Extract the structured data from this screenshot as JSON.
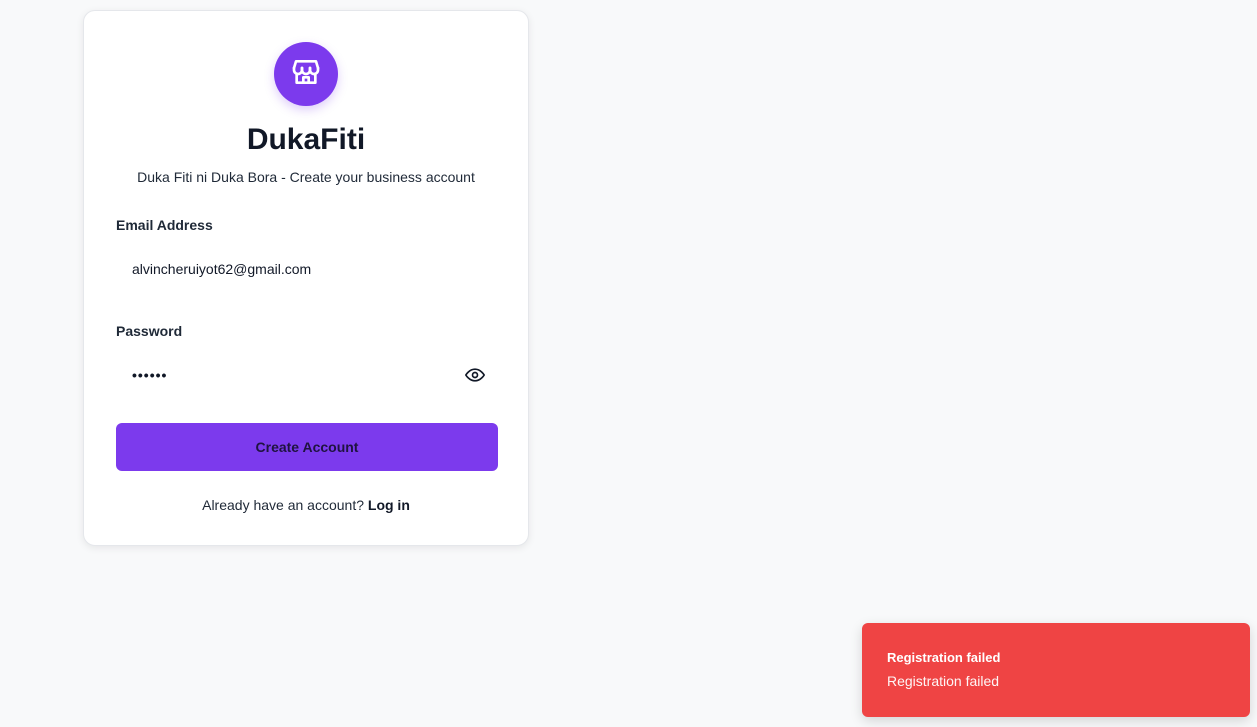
{
  "app": {
    "name": "DukaFiti",
    "tagline": "Duka Fiti ni Duka Bora - Create your business account",
    "logo_icon": "store-icon",
    "accent_color": "#7c3aed"
  },
  "form": {
    "email": {
      "label": "Email Address",
      "value": "alvincheruiyot62@gmail.com"
    },
    "password": {
      "label": "Password",
      "value": "••••••",
      "toggle_icon": "eye-icon"
    },
    "submit_label": "Create Account"
  },
  "footer": {
    "prompt": "Already have an account?",
    "link": "Log in"
  },
  "toast": {
    "title": "Registration failed",
    "description": "Registration failed",
    "color": "#ef4444"
  }
}
